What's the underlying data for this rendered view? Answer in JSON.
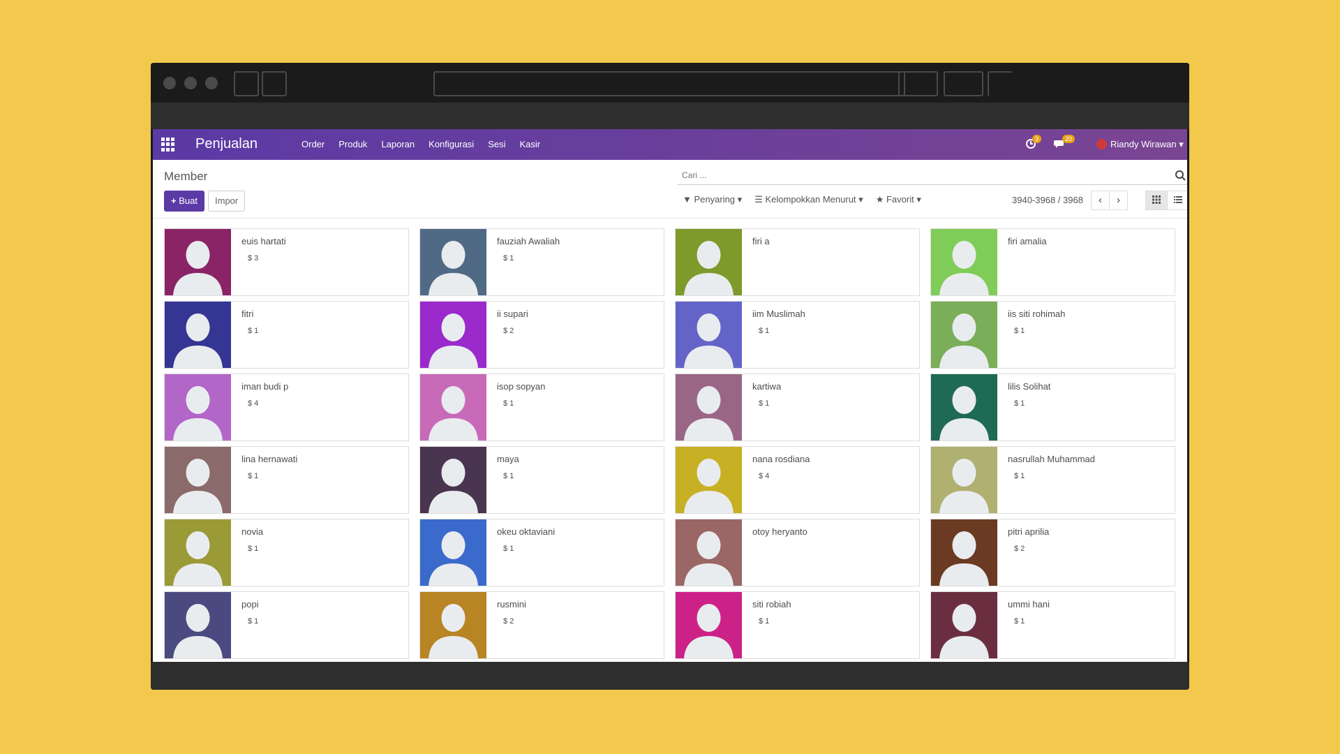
{
  "app": {
    "name": "Penjualan",
    "menu": [
      "Order",
      "Produk",
      "Laporan",
      "Konfigurasi",
      "Sesi",
      "Kasir"
    ],
    "activity_count": "3",
    "message_count": "20",
    "user_name": "Riandy Wirawan"
  },
  "control_panel": {
    "breadcrumb": "Member",
    "create_label": "Buat",
    "import_label": "Impor",
    "search_placeholder": "Cari ...",
    "filter_label": "Penyaring",
    "group_label": "Kelompokkan Menurut",
    "favorite_label": "Favorit",
    "pager_text": "3940-3968 / 3968"
  },
  "members": [
    {
      "name": "euis hartati",
      "amount": "$ 3",
      "color": "#8B2466"
    },
    {
      "name": "fauziah Awaliah",
      "amount": "$ 1",
      "color": "#506A86"
    },
    {
      "name": "firi a",
      "amount": "",
      "color": "#7D9A2A"
    },
    {
      "name": "firi amalia",
      "amount": "",
      "color": "#80CC58"
    },
    {
      "name": "fitri",
      "amount": "$ 1",
      "color": "#353594"
    },
    {
      "name": "ii supari",
      "amount": "$ 2",
      "color": "#9A2ACC"
    },
    {
      "name": "iim Muslimah",
      "amount": "$ 1",
      "color": "#6464C8"
    },
    {
      "name": "iis siti rohimah",
      "amount": "$ 1",
      "color": "#7BAE58"
    },
    {
      "name": "iman budi p",
      "amount": "$ 4",
      "color": "#B266C8"
    },
    {
      "name": "isop sopyan",
      "amount": "$ 1",
      "color": "#C86AB8"
    },
    {
      "name": "kartiwa",
      "amount": "$ 1",
      "color": "#9A6686"
    },
    {
      "name": "lilis Solihat",
      "amount": "$ 1",
      "color": "#1F6A54"
    },
    {
      "name": "lina hernawati",
      "amount": "$ 1",
      "color": "#8A6A6A"
    },
    {
      "name": "maya",
      "amount": "$ 1",
      "color": "#4A3550"
    },
    {
      "name": "nana rosdiana",
      "amount": "$ 4",
      "color": "#C8B024"
    },
    {
      "name": "nasrullah Muhammad",
      "amount": "$ 1",
      "color": "#B0B070"
    },
    {
      "name": "novia",
      "amount": "$ 1",
      "color": "#9A9A36"
    },
    {
      "name": "okeu oktaviani",
      "amount": "$ 1",
      "color": "#3A6ACC"
    },
    {
      "name": "otoy heryanto",
      "amount": "",
      "color": "#9A6666"
    },
    {
      "name": "pitri aprilia",
      "amount": "$ 2",
      "color": "#6A3A22"
    },
    {
      "name": "popi",
      "amount": "$ 1",
      "color": "#4A4A80"
    },
    {
      "name": "rusmini",
      "amount": "$ 2",
      "color": "#B88424"
    },
    {
      "name": "siti robiah",
      "amount": "$ 1",
      "color": "#CC2288"
    },
    {
      "name": "ummi hani",
      "amount": "$ 1",
      "color": "#6A2E40"
    }
  ]
}
